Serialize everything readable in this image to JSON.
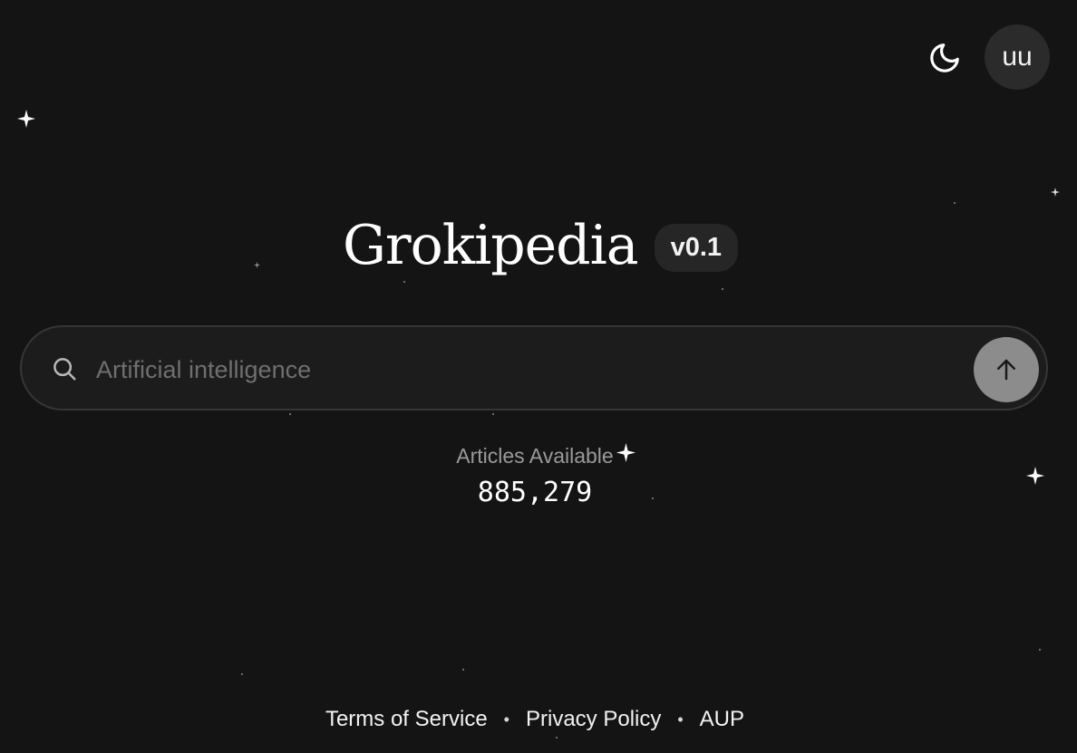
{
  "header": {
    "theme_icon": "moon-icon",
    "avatar_initials": "uu"
  },
  "brand": {
    "name": "Grokipedia",
    "version": "v0.1"
  },
  "search": {
    "placeholder": "Artificial intelligence",
    "value": "",
    "search_icon": "search-icon",
    "submit_icon": "arrow-up-icon"
  },
  "stats": {
    "label": "Articles Available",
    "count": "885,279"
  },
  "footer": {
    "links": [
      "Terms of Service",
      "Privacy Policy",
      "AUP"
    ],
    "separator": "•"
  },
  "colors": {
    "background": "#141414",
    "search_background": "#1c1c1c",
    "search_border": "#363636",
    "submit_button": "#8c8c8c",
    "badge_background": "#262626",
    "avatar_background": "#2b2b2b"
  }
}
